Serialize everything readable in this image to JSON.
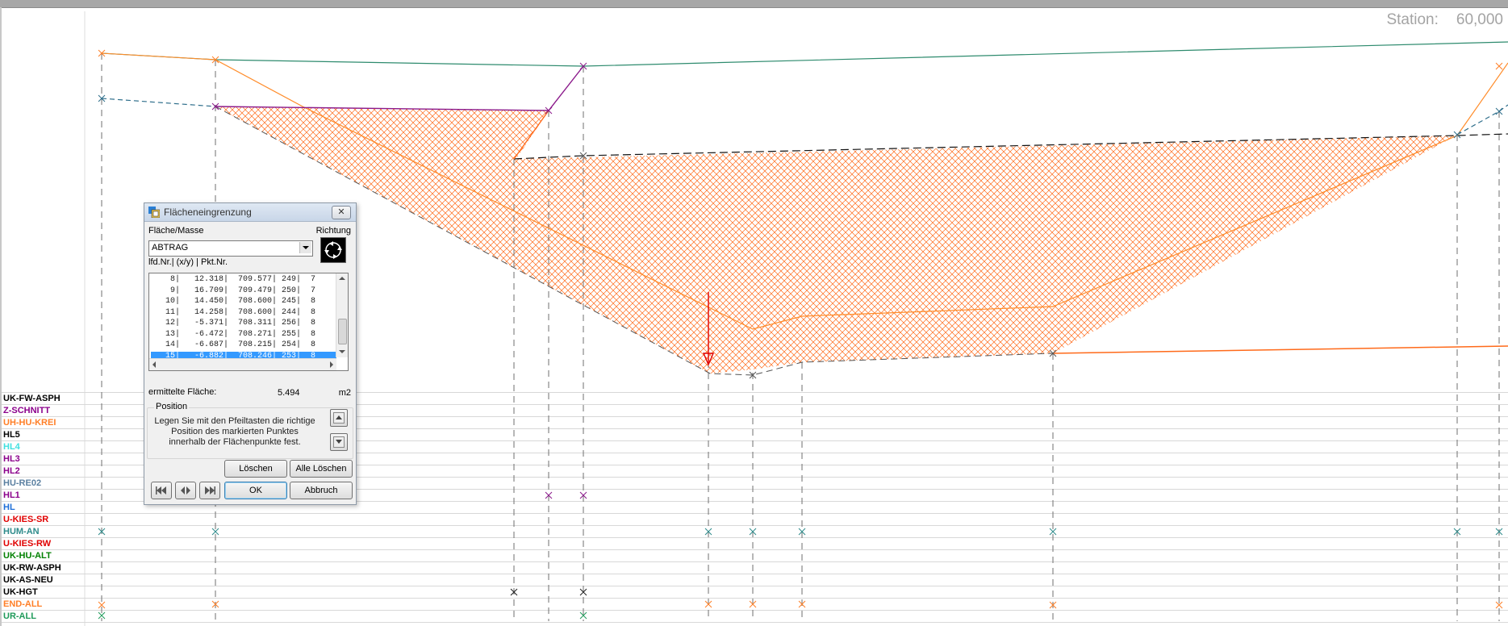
{
  "station": {
    "label": "Station:",
    "value": "60,000"
  },
  "layers": [
    {
      "name": "UK-FW-ASPH",
      "color": "#000000"
    },
    {
      "name": "Z-SCHNITT",
      "color": "#8b008b"
    },
    {
      "name": "UH-HU-KREI",
      "color": "#ff7f27"
    },
    {
      "name": "HL5",
      "color": "#000000"
    },
    {
      "name": "HL4",
      "color": "#40e0e0"
    },
    {
      "name": "HL3",
      "color": "#8b008b"
    },
    {
      "name": "HL2",
      "color": "#8b008b"
    },
    {
      "name": "HU-RE02",
      "color": "#5a7fa0"
    },
    {
      "name": "HL1",
      "color": "#8b008b"
    },
    {
      "name": "HL",
      "color": "#1e6fd9"
    },
    {
      "name": "U-KIES-SR",
      "color": "#e00000"
    },
    {
      "name": "HUM-AN",
      "color": "#2e8b8b"
    },
    {
      "name": "U-KIES-RW",
      "color": "#e00000"
    },
    {
      "name": "UK-HU-ALT",
      "color": "#008000"
    },
    {
      "name": "UK-RW-ASPH",
      "color": "#000000"
    },
    {
      "name": "UK-AS-NEU",
      "color": "#000000"
    },
    {
      "name": "UK-HGT",
      "color": "#000000"
    },
    {
      "name": "END-ALL",
      "color": "#ff7f27"
    },
    {
      "name": "UR-ALL",
      "color": "#1f9a5a"
    }
  ],
  "dialog": {
    "title": "Flächeneingrenzung",
    "close_label": "✕",
    "area_mass_label": "Fläche/Masse",
    "direction_label": "Richtung",
    "selected_type": "ABTRAG",
    "list_header": "lfd.Nr.|    (x/y)  | Pkt.Nr.",
    "rows": [
      "    8|   12.318|  709.577| 249|  7",
      "    9|   16.709|  709.479| 250|  7",
      "   10|   14.450|  708.600| 245|  8",
      "   11|   14.258|  708.600| 244|  8",
      "   12|   -5.371|  708.311| 256|  8",
      "   13|   -6.472|  708.271| 255|  8",
      "   14|   -6.687|  708.215| 254|  8",
      "   15|   -6.882|  708.246| 253|  8"
    ],
    "selected_row": 7,
    "area_label": "ermittelte Fläche:",
    "area_value": "5.494",
    "area_unit": "m2",
    "position_title": "Position",
    "position_text": "Legen Sie mit den Pfeiltasten die richtige Position des markierten Punktes innerhalb der Flächenpunkte fest.",
    "delete_label": "Löschen",
    "delete_all_label": "Alle Löschen",
    "ok_label": "OK",
    "cancel_label": "Abbruch"
  },
  "colors": {
    "hatch": "#ff6a1a",
    "terrain": "#ff8c2a",
    "top_line": "#2e8b6e",
    "magenta": "#8b1a8b",
    "red_marker": "#e00000",
    "dashed": "#555555"
  }
}
